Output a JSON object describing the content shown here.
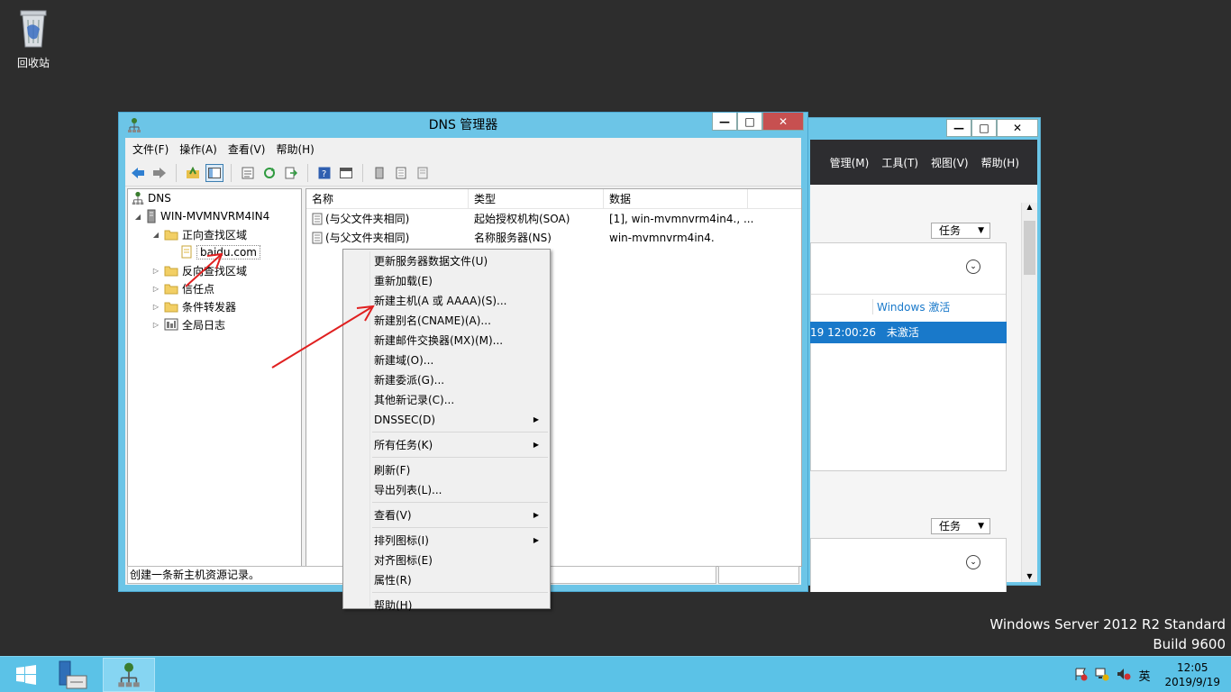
{
  "desktop": {
    "recycle_bin_label": "回收站"
  },
  "watermark": {
    "line1": "Windows Server 2012 R2 Standard",
    "line2": "Build 9600"
  },
  "bg_window": {
    "controls": {
      "minimize": "—",
      "maximize": "□",
      "close": "✕"
    },
    "menu": [
      "管理(M)",
      "工具(T)",
      "视图(V)",
      "帮助(H)"
    ],
    "task_label": "任务",
    "column_header": "Windows 激活",
    "selected_row": {
      "time": "19 12:00:26",
      "status": "未激活"
    },
    "task_label_2": "任务"
  },
  "dns_window": {
    "title": "DNS 管理器",
    "controls": {
      "minimize": "—",
      "maximize": "□",
      "close": "✕"
    },
    "menu": {
      "file": "文件(F)",
      "action": "操作(A)",
      "view": "查看(V)",
      "help": "帮助(H)"
    },
    "tree": {
      "root": "DNS",
      "server": "WIN-MVMNVRM4IN4",
      "forward_zones": "正向查找区域",
      "zone": "baidu.com",
      "reverse_zones": "反向查找区域",
      "trust_points": "信任点",
      "conditional_forwarders": "条件转发器",
      "global_logs": "全局日志"
    },
    "list": {
      "headers": {
        "name": "名称",
        "type": "类型",
        "data": "数据"
      },
      "rows": [
        {
          "name": "(与父文件夹相同)",
          "type": "起始授权机构(SOA)",
          "data": "[1], win-mvmnvrm4in4., ..."
        },
        {
          "name": "(与父文件夹相同)",
          "type": "名称服务器(NS)",
          "data": "win-mvmnvrm4in4."
        }
      ]
    },
    "status": "创建一条新主机资源记录。"
  },
  "context_menu": {
    "update_server_file": "更新服务器数据文件(U)",
    "reload": "重新加载(E)",
    "new_host": "新建主机(A 或 AAAA)(S)...",
    "new_alias": "新建别名(CNAME)(A)...",
    "new_mx": "新建邮件交换器(MX)(M)...",
    "new_domain": "新建域(O)...",
    "new_delegation": "新建委派(G)...",
    "other_records": "其他新记录(C)...",
    "dnssec": "DNSSEC(D)",
    "all_tasks": "所有任务(K)",
    "refresh": "刷新(F)",
    "export_list": "导出列表(L)...",
    "view": "查看(V)",
    "arrange_icons": "排列图标(I)",
    "line_up_icons": "对齐图标(E)",
    "properties": "属性(R)",
    "help": "帮助(H)"
  },
  "taskbar": {
    "ime": "英",
    "time": "12:05",
    "date": "2019/9/19"
  },
  "colors": {
    "accent": "#6cc5e7",
    "taskbar": "#5bc2e7",
    "selection": "#1979ca",
    "arrow": "#e02020"
  }
}
